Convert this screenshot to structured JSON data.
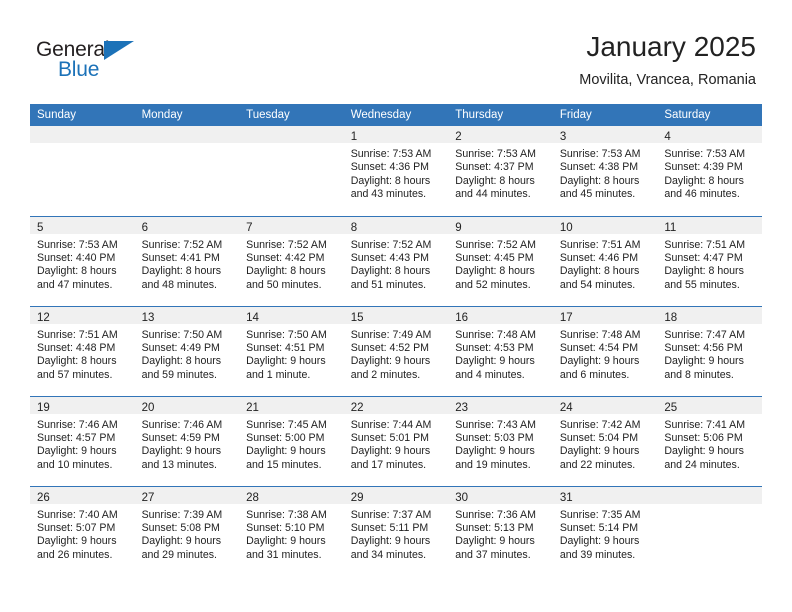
{
  "brand": {
    "name_top": "General",
    "name_bottom": "Blue",
    "accent_color": "#1c72b8"
  },
  "header": {
    "title": "January 2025",
    "subtitle": "Movilita, Vrancea, Romania"
  },
  "theme": {
    "header_row_bg": "#3275b8",
    "daynum_band_bg": "#f0f0f0",
    "text_color": "#222222",
    "page_bg": "#ffffff"
  },
  "weekday_headers": [
    "Sunday",
    "Monday",
    "Tuesday",
    "Wednesday",
    "Thursday",
    "Friday",
    "Saturday"
  ],
  "weeks": [
    [
      {
        "day": "",
        "sunrise": "",
        "sunset": "",
        "daylight_line1": "",
        "daylight_line2": ""
      },
      {
        "day": "",
        "sunrise": "",
        "sunset": "",
        "daylight_line1": "",
        "daylight_line2": ""
      },
      {
        "day": "",
        "sunrise": "",
        "sunset": "",
        "daylight_line1": "",
        "daylight_line2": ""
      },
      {
        "day": "1",
        "sunrise": "Sunrise: 7:53 AM",
        "sunset": "Sunset: 4:36 PM",
        "daylight_line1": "Daylight: 8 hours",
        "daylight_line2": "and 43 minutes."
      },
      {
        "day": "2",
        "sunrise": "Sunrise: 7:53 AM",
        "sunset": "Sunset: 4:37 PM",
        "daylight_line1": "Daylight: 8 hours",
        "daylight_line2": "and 44 minutes."
      },
      {
        "day": "3",
        "sunrise": "Sunrise: 7:53 AM",
        "sunset": "Sunset: 4:38 PM",
        "daylight_line1": "Daylight: 8 hours",
        "daylight_line2": "and 45 minutes."
      },
      {
        "day": "4",
        "sunrise": "Sunrise: 7:53 AM",
        "sunset": "Sunset: 4:39 PM",
        "daylight_line1": "Daylight: 8 hours",
        "daylight_line2": "and 46 minutes."
      }
    ],
    [
      {
        "day": "5",
        "sunrise": "Sunrise: 7:53 AM",
        "sunset": "Sunset: 4:40 PM",
        "daylight_line1": "Daylight: 8 hours",
        "daylight_line2": "and 47 minutes."
      },
      {
        "day": "6",
        "sunrise": "Sunrise: 7:52 AM",
        "sunset": "Sunset: 4:41 PM",
        "daylight_line1": "Daylight: 8 hours",
        "daylight_line2": "and 48 minutes."
      },
      {
        "day": "7",
        "sunrise": "Sunrise: 7:52 AM",
        "sunset": "Sunset: 4:42 PM",
        "daylight_line1": "Daylight: 8 hours",
        "daylight_line2": "and 50 minutes."
      },
      {
        "day": "8",
        "sunrise": "Sunrise: 7:52 AM",
        "sunset": "Sunset: 4:43 PM",
        "daylight_line1": "Daylight: 8 hours",
        "daylight_line2": "and 51 minutes."
      },
      {
        "day": "9",
        "sunrise": "Sunrise: 7:52 AM",
        "sunset": "Sunset: 4:45 PM",
        "daylight_line1": "Daylight: 8 hours",
        "daylight_line2": "and 52 minutes."
      },
      {
        "day": "10",
        "sunrise": "Sunrise: 7:51 AM",
        "sunset": "Sunset: 4:46 PM",
        "daylight_line1": "Daylight: 8 hours",
        "daylight_line2": "and 54 minutes."
      },
      {
        "day": "11",
        "sunrise": "Sunrise: 7:51 AM",
        "sunset": "Sunset: 4:47 PM",
        "daylight_line1": "Daylight: 8 hours",
        "daylight_line2": "and 55 minutes."
      }
    ],
    [
      {
        "day": "12",
        "sunrise": "Sunrise: 7:51 AM",
        "sunset": "Sunset: 4:48 PM",
        "daylight_line1": "Daylight: 8 hours",
        "daylight_line2": "and 57 minutes."
      },
      {
        "day": "13",
        "sunrise": "Sunrise: 7:50 AM",
        "sunset": "Sunset: 4:49 PM",
        "daylight_line1": "Daylight: 8 hours",
        "daylight_line2": "and 59 minutes."
      },
      {
        "day": "14",
        "sunrise": "Sunrise: 7:50 AM",
        "sunset": "Sunset: 4:51 PM",
        "daylight_line1": "Daylight: 9 hours",
        "daylight_line2": "and 1 minute."
      },
      {
        "day": "15",
        "sunrise": "Sunrise: 7:49 AM",
        "sunset": "Sunset: 4:52 PM",
        "daylight_line1": "Daylight: 9 hours",
        "daylight_line2": "and 2 minutes."
      },
      {
        "day": "16",
        "sunrise": "Sunrise: 7:48 AM",
        "sunset": "Sunset: 4:53 PM",
        "daylight_line1": "Daylight: 9 hours",
        "daylight_line2": "and 4 minutes."
      },
      {
        "day": "17",
        "sunrise": "Sunrise: 7:48 AM",
        "sunset": "Sunset: 4:54 PM",
        "daylight_line1": "Daylight: 9 hours",
        "daylight_line2": "and 6 minutes."
      },
      {
        "day": "18",
        "sunrise": "Sunrise: 7:47 AM",
        "sunset": "Sunset: 4:56 PM",
        "daylight_line1": "Daylight: 9 hours",
        "daylight_line2": "and 8 minutes."
      }
    ],
    [
      {
        "day": "19",
        "sunrise": "Sunrise: 7:46 AM",
        "sunset": "Sunset: 4:57 PM",
        "daylight_line1": "Daylight: 9 hours",
        "daylight_line2": "and 10 minutes."
      },
      {
        "day": "20",
        "sunrise": "Sunrise: 7:46 AM",
        "sunset": "Sunset: 4:59 PM",
        "daylight_line1": "Daylight: 9 hours",
        "daylight_line2": "and 13 minutes."
      },
      {
        "day": "21",
        "sunrise": "Sunrise: 7:45 AM",
        "sunset": "Sunset: 5:00 PM",
        "daylight_line1": "Daylight: 9 hours",
        "daylight_line2": "and 15 minutes."
      },
      {
        "day": "22",
        "sunrise": "Sunrise: 7:44 AM",
        "sunset": "Sunset: 5:01 PM",
        "daylight_line1": "Daylight: 9 hours",
        "daylight_line2": "and 17 minutes."
      },
      {
        "day": "23",
        "sunrise": "Sunrise: 7:43 AM",
        "sunset": "Sunset: 5:03 PM",
        "daylight_line1": "Daylight: 9 hours",
        "daylight_line2": "and 19 minutes."
      },
      {
        "day": "24",
        "sunrise": "Sunrise: 7:42 AM",
        "sunset": "Sunset: 5:04 PM",
        "daylight_line1": "Daylight: 9 hours",
        "daylight_line2": "and 22 minutes."
      },
      {
        "day": "25",
        "sunrise": "Sunrise: 7:41 AM",
        "sunset": "Sunset: 5:06 PM",
        "daylight_line1": "Daylight: 9 hours",
        "daylight_line2": "and 24 minutes."
      }
    ],
    [
      {
        "day": "26",
        "sunrise": "Sunrise: 7:40 AM",
        "sunset": "Sunset: 5:07 PM",
        "daylight_line1": "Daylight: 9 hours",
        "daylight_line2": "and 26 minutes."
      },
      {
        "day": "27",
        "sunrise": "Sunrise: 7:39 AM",
        "sunset": "Sunset: 5:08 PM",
        "daylight_line1": "Daylight: 9 hours",
        "daylight_line2": "and 29 minutes."
      },
      {
        "day": "28",
        "sunrise": "Sunrise: 7:38 AM",
        "sunset": "Sunset: 5:10 PM",
        "daylight_line1": "Daylight: 9 hours",
        "daylight_line2": "and 31 minutes."
      },
      {
        "day": "29",
        "sunrise": "Sunrise: 7:37 AM",
        "sunset": "Sunset: 5:11 PM",
        "daylight_line1": "Daylight: 9 hours",
        "daylight_line2": "and 34 minutes."
      },
      {
        "day": "30",
        "sunrise": "Sunrise: 7:36 AM",
        "sunset": "Sunset: 5:13 PM",
        "daylight_line1": "Daylight: 9 hours",
        "daylight_line2": "and 37 minutes."
      },
      {
        "day": "31",
        "sunrise": "Sunrise: 7:35 AM",
        "sunset": "Sunset: 5:14 PM",
        "daylight_line1": "Daylight: 9 hours",
        "daylight_line2": "and 39 minutes."
      },
      {
        "day": "",
        "sunrise": "",
        "sunset": "",
        "daylight_line1": "",
        "daylight_line2": ""
      }
    ]
  ]
}
